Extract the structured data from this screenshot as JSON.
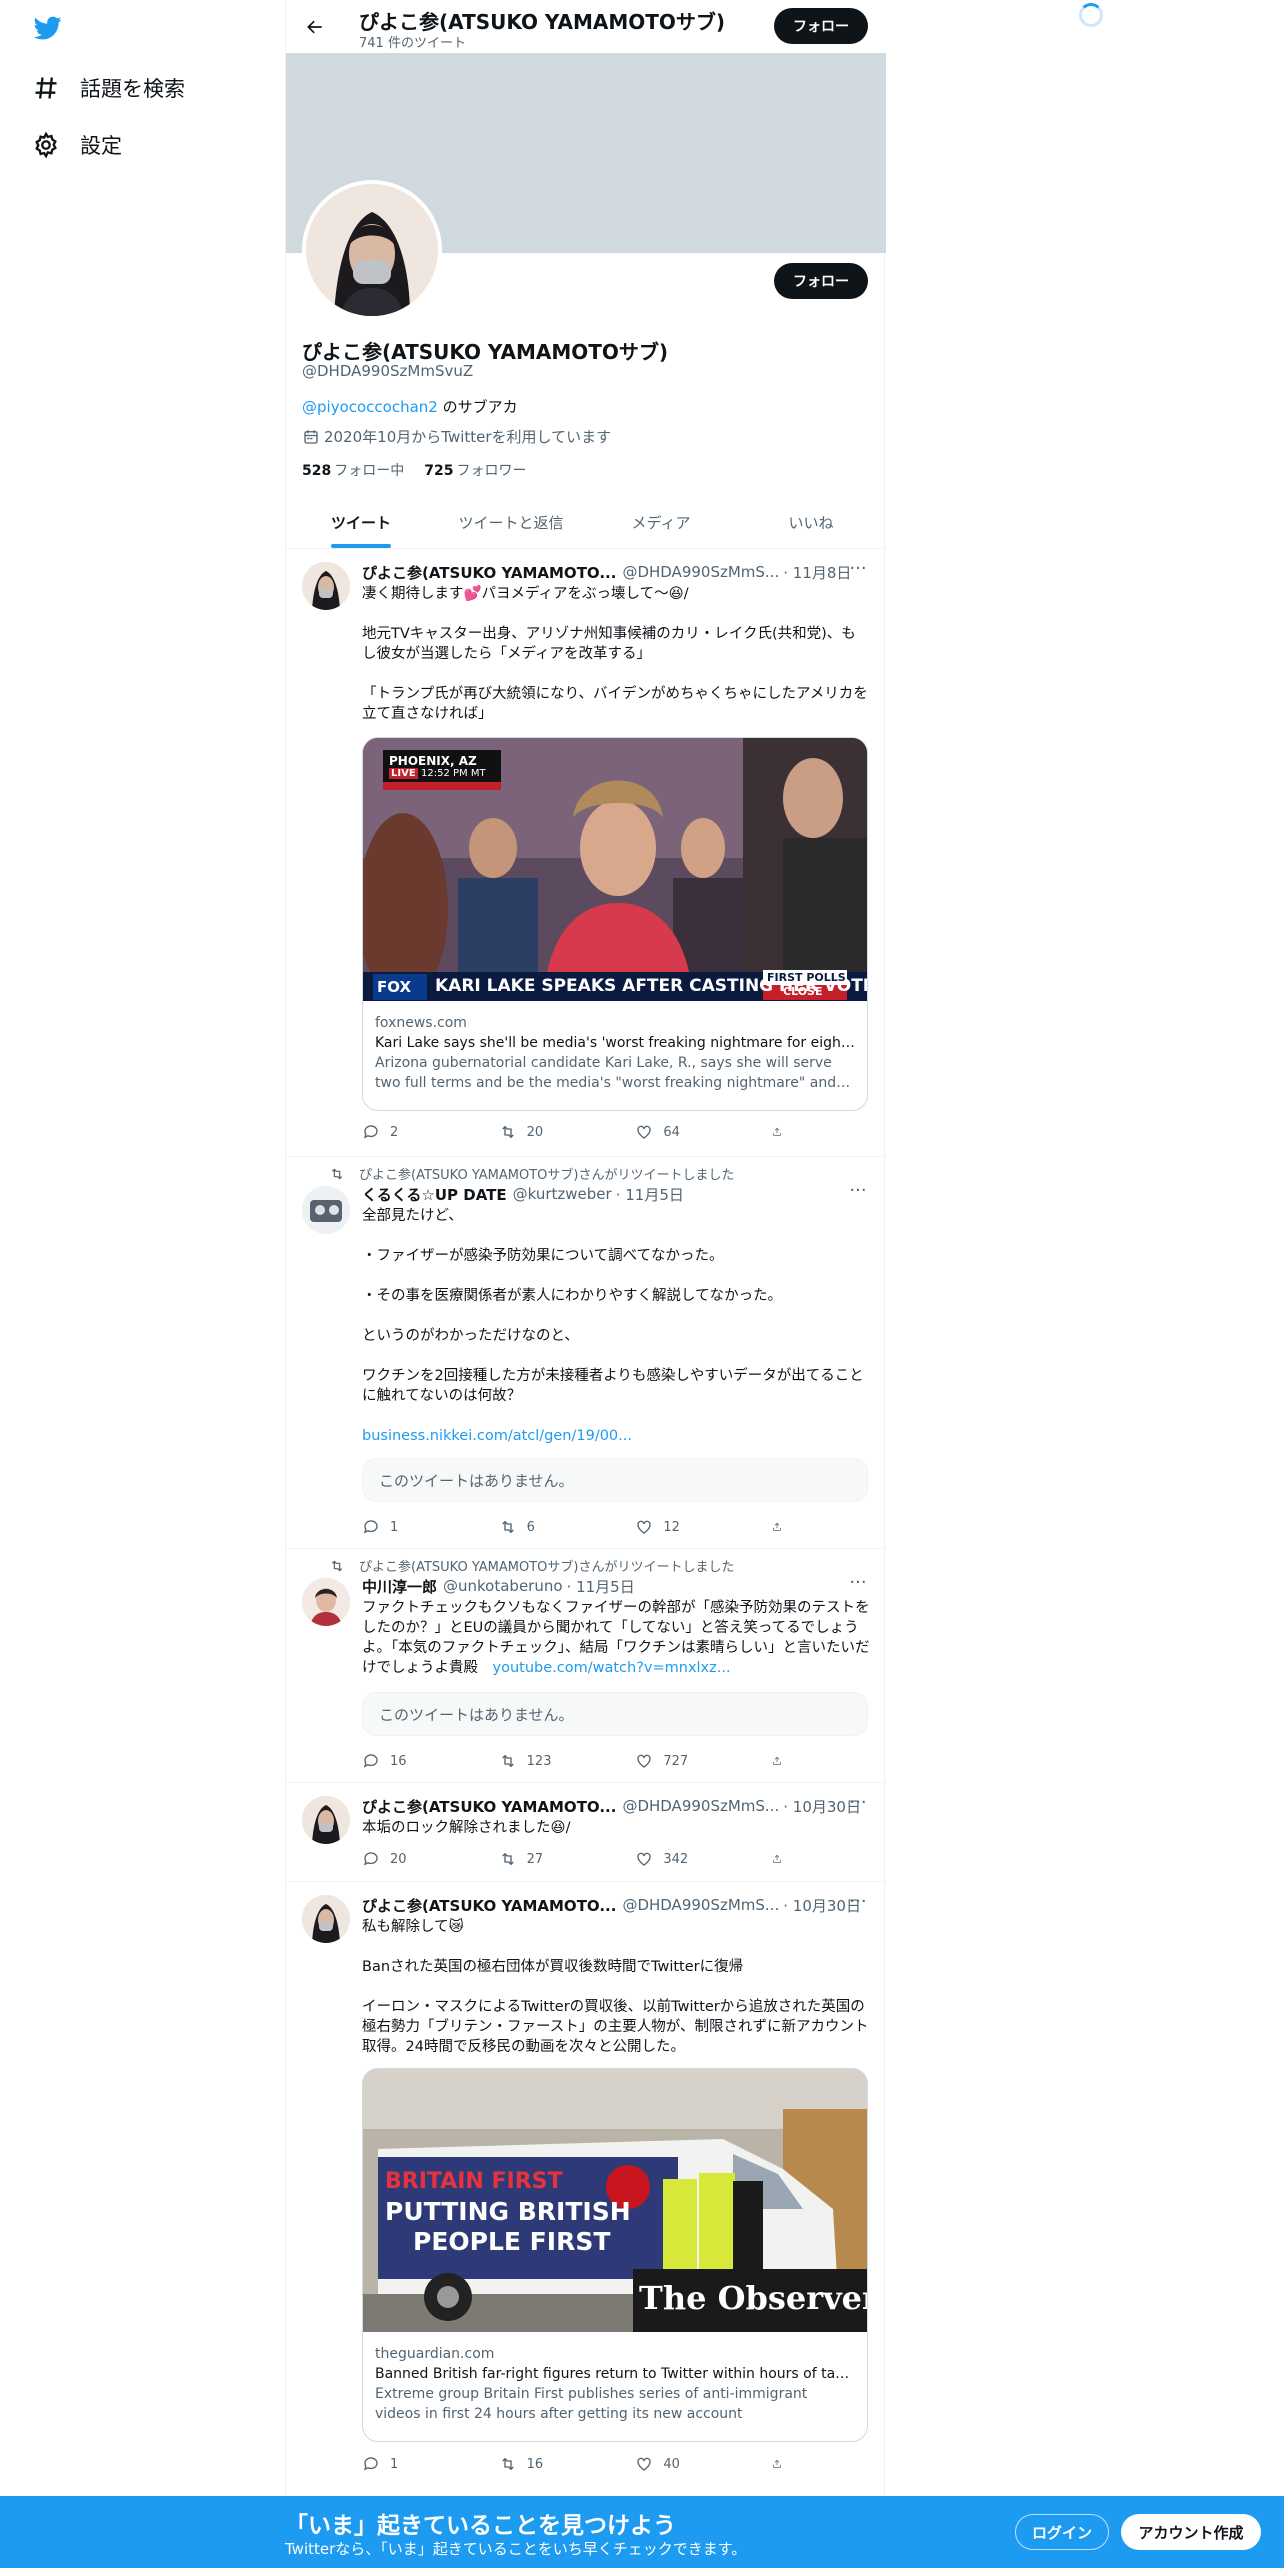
{
  "nav": {
    "logo_icon": "twitter-bird-icon",
    "items": [
      {
        "label": "話題を検索",
        "icon": "hashtag-icon"
      },
      {
        "label": "設定",
        "icon": "gear-icon"
      }
    ]
  },
  "header": {
    "name": "ぴよこ参(ATSUKO YAMAMOTOサブ)",
    "tweet_count": "741 件のツイート",
    "follow_label": "フォロー"
  },
  "profile": {
    "name": "ぴよこ参(ATSUKO YAMAMOTOサブ)",
    "handle": "@DHDA990SzMmSvuZ",
    "bio_mention": "@piyococcochan2",
    "bio_rest": " のサブアカ",
    "joined": "2020年10月からTwitterを利用しています",
    "following_count": "528",
    "following_label": "フォロー中",
    "followers_count": "725",
    "followers_label": "フォロワー",
    "follow_label": "フォロー"
  },
  "tabs": [
    "ツイート",
    "ツイートと返信",
    "メディア",
    "いいね"
  ],
  "tweets": [
    {
      "name": "ぴよこ参(ATSUKO YAMAMOTO...",
      "handle": "@DHDA990SzMmS...",
      "date": "· 11月8日",
      "text": "凄く期待します💕パヨメディアをぶっ壊して〜😆/\n\n地元TVキャスター出身、アリゾナ州知事候補のカリ・レイク氏(共和党)、もし彼女が当選したら「メディアを改革する」\n\n「トランプ氏が再び大統領になり、バイデンがめちゃくちゃにしたアメリカを立て直さなければ」",
      "card": {
        "location_tag": "PHOENIX, AZ",
        "live_tag": "LIVE",
        "time_tag": "12:52 PM MT",
        "network": "FOX",
        "headline": "KARI LAKE SPEAKS AFTER CASTING HER VOTE",
        "badge_top": "FIRST POLLS",
        "badge_bottom": "CLOSE",
        "domain": "foxnews.com",
        "title": "Kari Lake says she'll be media's 'worst freaking nightmare for eight ye...",
        "desc": "Arizona gubernatorial candidate Kari Lake, R., says she will serve two full terms and be the media's \"worst freaking nightmare\" and \"reform th..."
      },
      "replies": "2",
      "retweets": "20",
      "likes": "64"
    },
    {
      "retweet_by": "ぴよこ参(ATSUKO YAMAMOTOサブ)さんがリツイートしました",
      "name": "くるくる☆UP DATE",
      "handle": "@kurtzweber",
      "date": "· 11月5日",
      "text": "全部見たけど、\n\n・ファイザーが感染予防効果について調べてなかった。\n\n・その事を医療関係者が素人にわかりやすく解説してなかった。\n\nというのがわかっただけなのと、\n\nワクチンを2回接種した方が未接種者よりも感染しやすいデータが出てることに触れてないのは何故？",
      "link": "business.nikkei.com/atcl/gen/19/00...",
      "unavailable": "このツイートはありません。",
      "replies": "1",
      "retweets": "6",
      "likes": "12"
    },
    {
      "retweet_by": "ぴよこ参(ATSUKO YAMAMOTOサブ)さんがリツイートしました",
      "name": "中川淳一郎",
      "handle": "@unkotaberuno",
      "date": "· 11月5日",
      "text": "ファクトチェックもクソもなくファイザーの幹部が「感染予防効果のテストをしたのか？」とEUの議員から聞かれて「してない」と答え笑ってるでしょうよ。「本気のファクトチェック」、結局「ワクチンは素晴らしい」と言いたいだけでしょうよ貴殿",
      "link": "youtube.com/watch?v=mnxlxz...",
      "unavailable": "このツイートはありません。",
      "replies": "16",
      "retweets": "123",
      "likes": "727"
    },
    {
      "name": "ぴよこ参(ATSUKO YAMAMOTO...",
      "handle": "@DHDA990SzMmS...",
      "date": "· 10月30日",
      "text": "本垢のロック解除されました😆/",
      "replies": "20",
      "retweets": "27",
      "likes": "342"
    },
    {
      "name": "ぴよこ参(ATSUKO YAMAMOTO...",
      "handle": "@DHDA990SzMmS...",
      "date": "· 10月30日",
      "text": "私も解除して😿\n\nBanされた英国の極右団体が買収後数時間でTwitterに復帰\n\nイーロン・マスクによるTwitterの買収後、以前Twitterから追放された英国の極右勢力「ブリテン・ファースト」の主要人物が、制限されずに新アカウント取得。24時間で反移民の動画を次々と公開した。",
      "card": {
        "van_line1": "BRITAIN FIRST",
        "van_line2": "PUTTING BRITISH",
        "van_line3": "PEOPLE FIRST",
        "watermark": "The Observer",
        "domain": "theguardian.com",
        "title": "Banned British far-right figures return to Twitter within hours of takeover",
        "desc": "Extreme group Britain First publishes series of anti-immigrant videos in first 24 hours after getting its new account"
      },
      "replies": "1",
      "retweets": "16",
      "likes": "40"
    }
  ],
  "bottom": {
    "title": "「いま」起きていることを見つけよう",
    "subtitle": "Twitterなら、「いま」起きていることをいち早くチェックできます。",
    "login": "ログイン",
    "signup": "アカウント作成"
  },
  "colors": {
    "accent": "#1d9bf0",
    "text": "#0f1419",
    "secondary": "#536471",
    "banner": "#cfd9de"
  }
}
